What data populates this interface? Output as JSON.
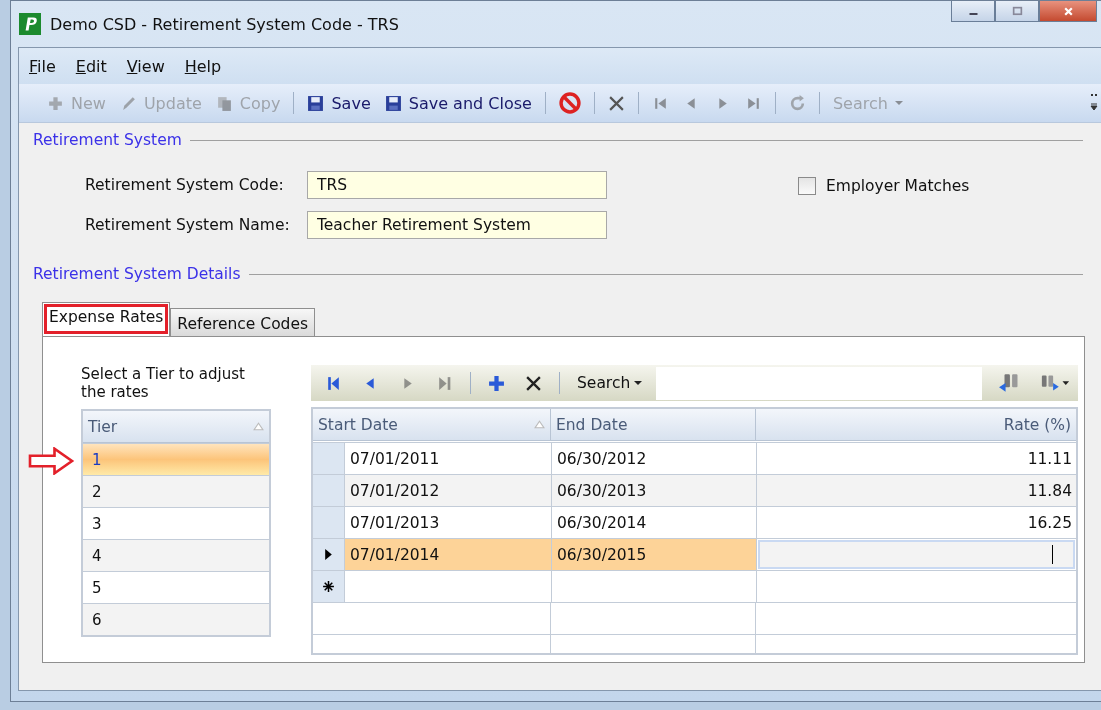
{
  "window": {
    "title": "Demo CSD - Retirement System Code - TRS"
  },
  "menu": [
    {
      "label": "File"
    },
    {
      "label": "Edit"
    },
    {
      "label": "View"
    },
    {
      "label": "Help"
    }
  ],
  "toolbar": [
    {
      "kind": "new",
      "label": "New",
      "disabled": true
    },
    {
      "kind": "update",
      "label": "Update",
      "disabled": true
    },
    {
      "kind": "copy",
      "label": "Copy",
      "disabled": true
    },
    {
      "kind": "separator"
    },
    {
      "kind": "save",
      "label": "Save",
      "disabled": false
    },
    {
      "kind": "save",
      "label": "Save and Close",
      "disabled": false
    },
    {
      "kind": "separator"
    },
    {
      "kind": "cancel",
      "disabled": false
    },
    {
      "kind": "separator"
    },
    {
      "kind": "delete",
      "disabled": false
    },
    {
      "kind": "separator"
    },
    {
      "kind": "first",
      "disabled": true
    },
    {
      "kind": "prev",
      "disabled": true
    },
    {
      "kind": "next",
      "disabled": true
    },
    {
      "kind": "last",
      "disabled": true
    },
    {
      "kind": "separator"
    },
    {
      "kind": "refresh",
      "disabled": true
    },
    {
      "kind": "separator"
    },
    {
      "kind": "search",
      "label": "Search",
      "disabled": true
    }
  ],
  "system": {
    "heading": "Retirement System",
    "fields": [
      {
        "label": "Retirement System Code:",
        "value": "TRS"
      },
      {
        "label": "Retirement System Name:",
        "value": "Teacher Retirement System"
      }
    ],
    "checkbox": {
      "label": "Employer Matches",
      "checked": false
    }
  },
  "details": {
    "heading": "Retirement System Details",
    "tabs": [
      {
        "label": "Expense Rates",
        "selected": true,
        "highlighted": true
      },
      {
        "label": "Reference Codes",
        "selected": false,
        "highlighted": false
      }
    ],
    "tier_caption": "Select a Tier to adjust the rates",
    "tier_column": "Tier",
    "tiers": [
      {
        "tier": "1",
        "selected": true,
        "pointed": true
      },
      {
        "tier": "2",
        "selected": false,
        "pointed": false
      },
      {
        "tier": "3",
        "selected": false,
        "pointed": false
      },
      {
        "tier": "4",
        "selected": false,
        "pointed": false
      },
      {
        "tier": "5",
        "selected": false,
        "pointed": false
      },
      {
        "tier": "6",
        "selected": false,
        "pointed": false
      }
    ],
    "grid_toolbar": [
      {
        "kind": "first",
        "disabled": false
      },
      {
        "kind": "prev",
        "disabled": false
      },
      {
        "kind": "next",
        "disabled": true
      },
      {
        "kind": "last",
        "disabled": true
      },
      {
        "kind": "separator"
      },
      {
        "kind": "add",
        "disabled": false
      },
      {
        "kind": "delete",
        "disabled": false
      },
      {
        "kind": "separator"
      },
      {
        "kind": "search",
        "label": "Search",
        "disabled": false
      }
    ],
    "columns": [
      "Start Date",
      "End Date",
      "Rate (%)"
    ],
    "rows": [
      {
        "start": "07/01/2011",
        "end": "06/30/2012",
        "rate": "11.11",
        "selected": false
      },
      {
        "start": "07/01/2012",
        "end": "06/30/2013",
        "rate": "11.84",
        "selected": false
      },
      {
        "start": "07/01/2013",
        "end": "06/30/2014",
        "rate": "16.25",
        "selected": false
      },
      {
        "start": "07/01/2014",
        "end": "06/30/2015",
        "rate": "",
        "selected": true
      }
    ]
  }
}
